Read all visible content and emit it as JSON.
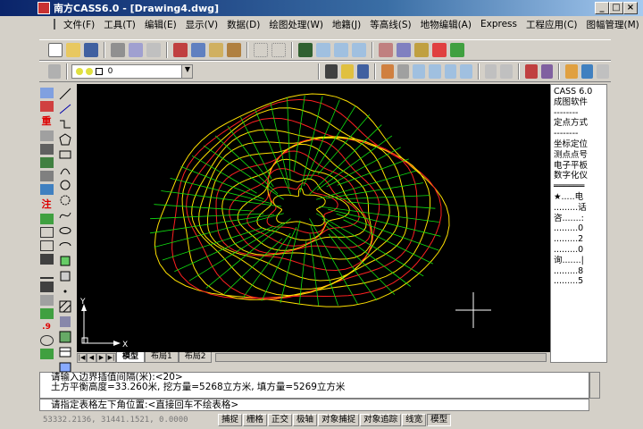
{
  "window": {
    "title": "南方CASS6.0 - [Drawing4.dwg]"
  },
  "menu": [
    "文件(F)",
    "工具(T)",
    "编辑(E)",
    "显示(V)",
    "数据(D)",
    "绘图处理(W)",
    "地籍(J)",
    "等高线(S)",
    "地物编辑(A)",
    "Express",
    "工程应用(C)",
    "图幅管理(M)"
  ],
  "layer": {
    "current": "0"
  },
  "left_tools_a": [
    "",
    "",
    "重",
    "",
    "",
    "",
    "",
    "",
    "注",
    "",
    "",
    "",
    "",
    "",
    "",
    "",
    "",
    ".9",
    "",
    ""
  ],
  "left_tools_b": [
    "",
    "",
    "",
    "",
    "",
    "",
    "",
    "",
    "",
    "",
    "",
    "",
    "",
    "",
    "",
    "",
    "",
    "",
    "",
    "A"
  ],
  "tabs": [
    "模型",
    "布局1",
    "布局2"
  ],
  "side_menu": [
    "CASS 6.0",
    "成图软件",
    "--------",
    "定点方式",
    "--------",
    "坐标定位",
    "测点点号",
    "电子平板",
    "数字化仪",
    "══════",
    "★.....电",
    ".........话",
    "咨.......:",
    ".........0",
    ".........2",
    ".........0",
    "询.......|",
    ".........8",
    ".........5"
  ],
  "command": {
    "line1": "请输入边界插值间隔(米):<20>",
    "line2": "土方平衡高度=33.260米, 挖方量=5268立方米, 填方量=5269立方米",
    "prompt": "请指定表格左下角位置:<直接回车不绘表格>"
  },
  "status": {
    "coords": "53332.2136, 31441.1521, 0.0000",
    "buttons": [
      "捕捉",
      "栅格",
      "正交",
      "极轴",
      "对象捕捉",
      "对象追踪",
      "线宽",
      "模型"
    ]
  },
  "ucs": {
    "x": "X",
    "y": "Y"
  },
  "colors": {
    "contour_major": "#ffe000",
    "contour_minor": "#ff2020",
    "tin": "#10e010",
    "canvas_bg": "#000000"
  }
}
